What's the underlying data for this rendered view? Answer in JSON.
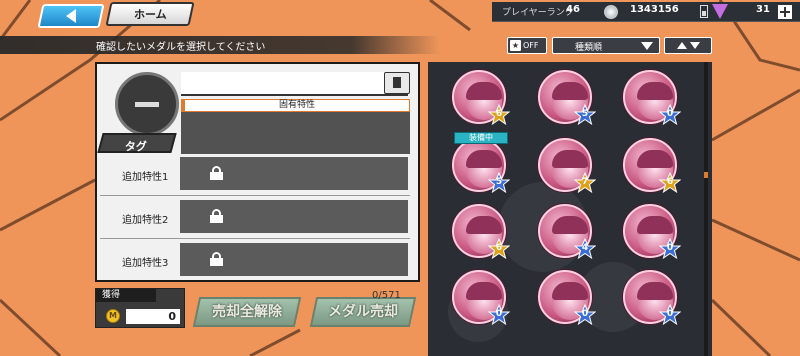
{
  "nav": {
    "home_label": "ホーム"
  },
  "status": {
    "rank_label": "プレイヤーランク",
    "rank_value": "46",
    "coins": "1343156",
    "gems": "31"
  },
  "instruction": "確認したいメダルを選択してください",
  "filter": {
    "toggle_label": "OFF",
    "sort_label": "種類順"
  },
  "detail": {
    "trait_header": "固有特性",
    "tag_label": "タグ",
    "bonus": [
      {
        "label": "追加特性1"
      },
      {
        "label": "追加特性2"
      },
      {
        "label": "追加特性3"
      }
    ]
  },
  "acquire": {
    "label": "獲得",
    "coin_symbol": "M",
    "value": "0"
  },
  "buttons": {
    "release_all": "売却全解除",
    "sell": "メダル売却"
  },
  "count": "0/571",
  "medals": [
    {
      "level": "6",
      "star_color": "#e0a21b"
    },
    {
      "level": "5",
      "star_color": "#3b6fd6"
    },
    {
      "level": "0",
      "star_color": "#3b6fd6"
    },
    {
      "level": "5",
      "star_color": "#3b6fd6",
      "equipped_label": "装備中"
    },
    {
      "level": "7",
      "star_color": "#e0a21b"
    },
    {
      "level": "6",
      "star_color": "#e0a21b"
    },
    {
      "level": "6",
      "star_color": "#e0a21b"
    },
    {
      "level": "4",
      "star_color": "#3b6fd6"
    },
    {
      "level": "0",
      "star_color": "#3b6fd6"
    },
    {
      "level": "0",
      "star_color": "#3b6fd6"
    },
    {
      "level": "0",
      "star_color": "#3b6fd6"
    },
    {
      "level": "0",
      "star_color": "#3b6fd6"
    }
  ]
}
